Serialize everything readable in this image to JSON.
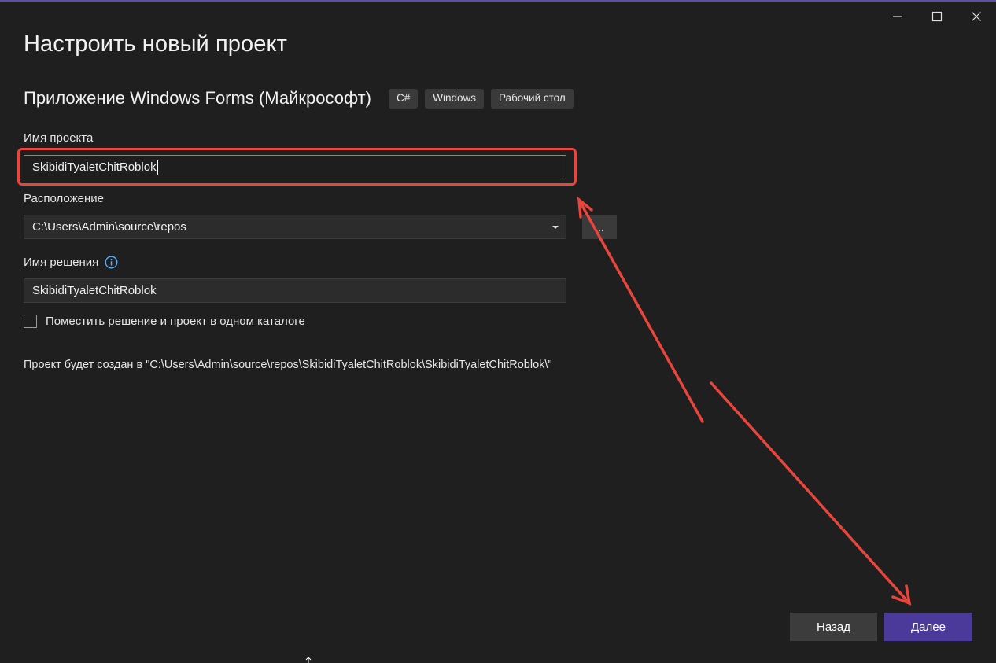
{
  "window": {
    "controls": {
      "minimize_icon": "minimize-icon",
      "maximize_icon": "maximize-icon",
      "close_icon": "close-icon"
    },
    "accent_color": "#5b4fa8"
  },
  "page": {
    "title": "Настроить новый проект"
  },
  "template": {
    "name": "Приложение Windows Forms (Майкрософт)",
    "tags": [
      "C#",
      "Windows",
      "Рабочий стол"
    ]
  },
  "form": {
    "project_name_label": "Имя проекта",
    "project_name_value": "SkibidiTyaletChitRoblok",
    "location_label": "Расположение",
    "location_value": "C:\\Users\\Admin\\source\\repos",
    "browse_label": "...",
    "solution_name_label": "Имя решения",
    "solution_name_value": "SkibidiTyaletChitRoblok",
    "same_folder_label": "Поместить решение и проект в одном каталоге",
    "same_folder_checked": false,
    "path_info": "Проект будет создан в \"C:\\Users\\Admin\\source\\repos\\SkibidiTyaletChitRoblok\\SkibidiTyaletChitRoblok\\\""
  },
  "footer": {
    "back_label": "Назад",
    "next_label": "Далее",
    "next_color": "#4b3a9a"
  },
  "annotation": {
    "highlight_color": "#e8453c"
  }
}
